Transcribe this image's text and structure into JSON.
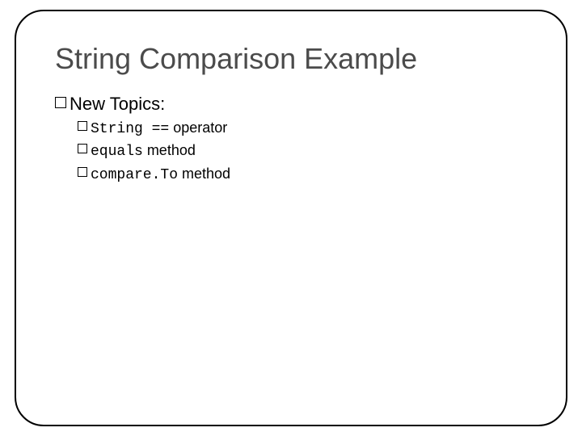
{
  "title": "String Comparison Example",
  "level1": {
    "label": "New Topics:"
  },
  "items": [
    {
      "code": "String ==",
      "rest": " operator"
    },
    {
      "code": "equals",
      "rest": " method"
    },
    {
      "code": "compare.To",
      "rest": " method"
    }
  ]
}
